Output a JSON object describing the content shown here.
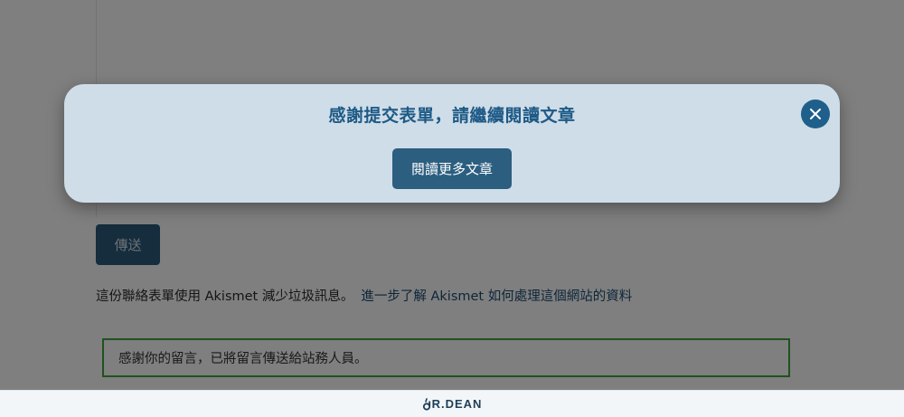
{
  "page": {
    "submit_label": "傳送",
    "akismet_text": "這份聯絡表單使用 Akismet 減少垃圾訊息。",
    "akismet_link": "進一步了解 Akismet 如何處理這個網站的資料",
    "success_message": "感謝你的留言，已將留言傳送給站務人員。"
  },
  "modal": {
    "title": "感謝提交表單，請繼續閱讀文章",
    "read_more_label": "閱讀更多文章",
    "close_icon": "close-icon"
  },
  "footer": {
    "brand_text": "R.DEAN",
    "brand_icon": "dr-dean-logo-icon"
  },
  "colors": {
    "modal_background": "#cfdde8",
    "accent": "#1f5f8b",
    "title": "#1e5a86",
    "success_border": "#3ea53c"
  }
}
